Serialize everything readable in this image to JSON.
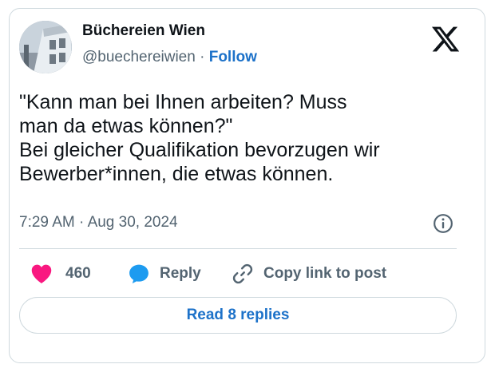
{
  "author": {
    "name": "Büchereien Wien",
    "handle": "@buechereiwien",
    "separator": "·",
    "follow_label": "Follow"
  },
  "post": {
    "lines": [
      "\"Kann man bei Ihnen arbeiten? Muss",
      "man da etwas können?\"",
      "Bei gleicher Qualifikation bevorzugen wir",
      "Bewerber*innen, die etwas können."
    ],
    "time": "7:29 AM",
    "date_separator": "·",
    "date": "Aug 30, 2024"
  },
  "actions": {
    "like_count": "460",
    "reply_label": "Reply",
    "copy_link_label": "Copy link to post"
  },
  "replies_button_label": "Read 8 replies",
  "icons": {
    "brand": "x-logo-icon",
    "info": "info-icon",
    "like": "heart-icon",
    "reply": "speech-bubble-icon",
    "copy": "link-icon"
  },
  "colors": {
    "like": "#f91880",
    "reply": "#1d9bf0",
    "link_blue": "#1d72c9",
    "muted": "#536471",
    "border": "#cfd9de"
  }
}
